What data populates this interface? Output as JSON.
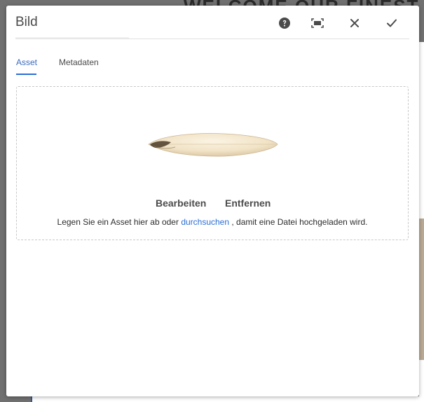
{
  "background": {
    "heading": "WELCOME OUR FINEST C"
  },
  "dialog": {
    "title": "Bild",
    "header_icons": [
      "help-icon",
      "fullscreen-icon",
      "close-icon",
      "checkmark-icon"
    ]
  },
  "tabs": [
    {
      "label": "Asset",
      "active": true
    },
    {
      "label": "Metadaten",
      "active": false
    }
  ],
  "dropzone": {
    "edit_label": "Bearbeiten",
    "remove_label": "Entfernen",
    "hint_before": "Legen Sie ein Asset hier ab oder ",
    "hint_link": "durchsuchen",
    "hint_after": " , damit eine Datei hochgeladen wird."
  },
  "colors": {
    "accent": "#2b6ed4",
    "text": "#4b4b4b"
  }
}
